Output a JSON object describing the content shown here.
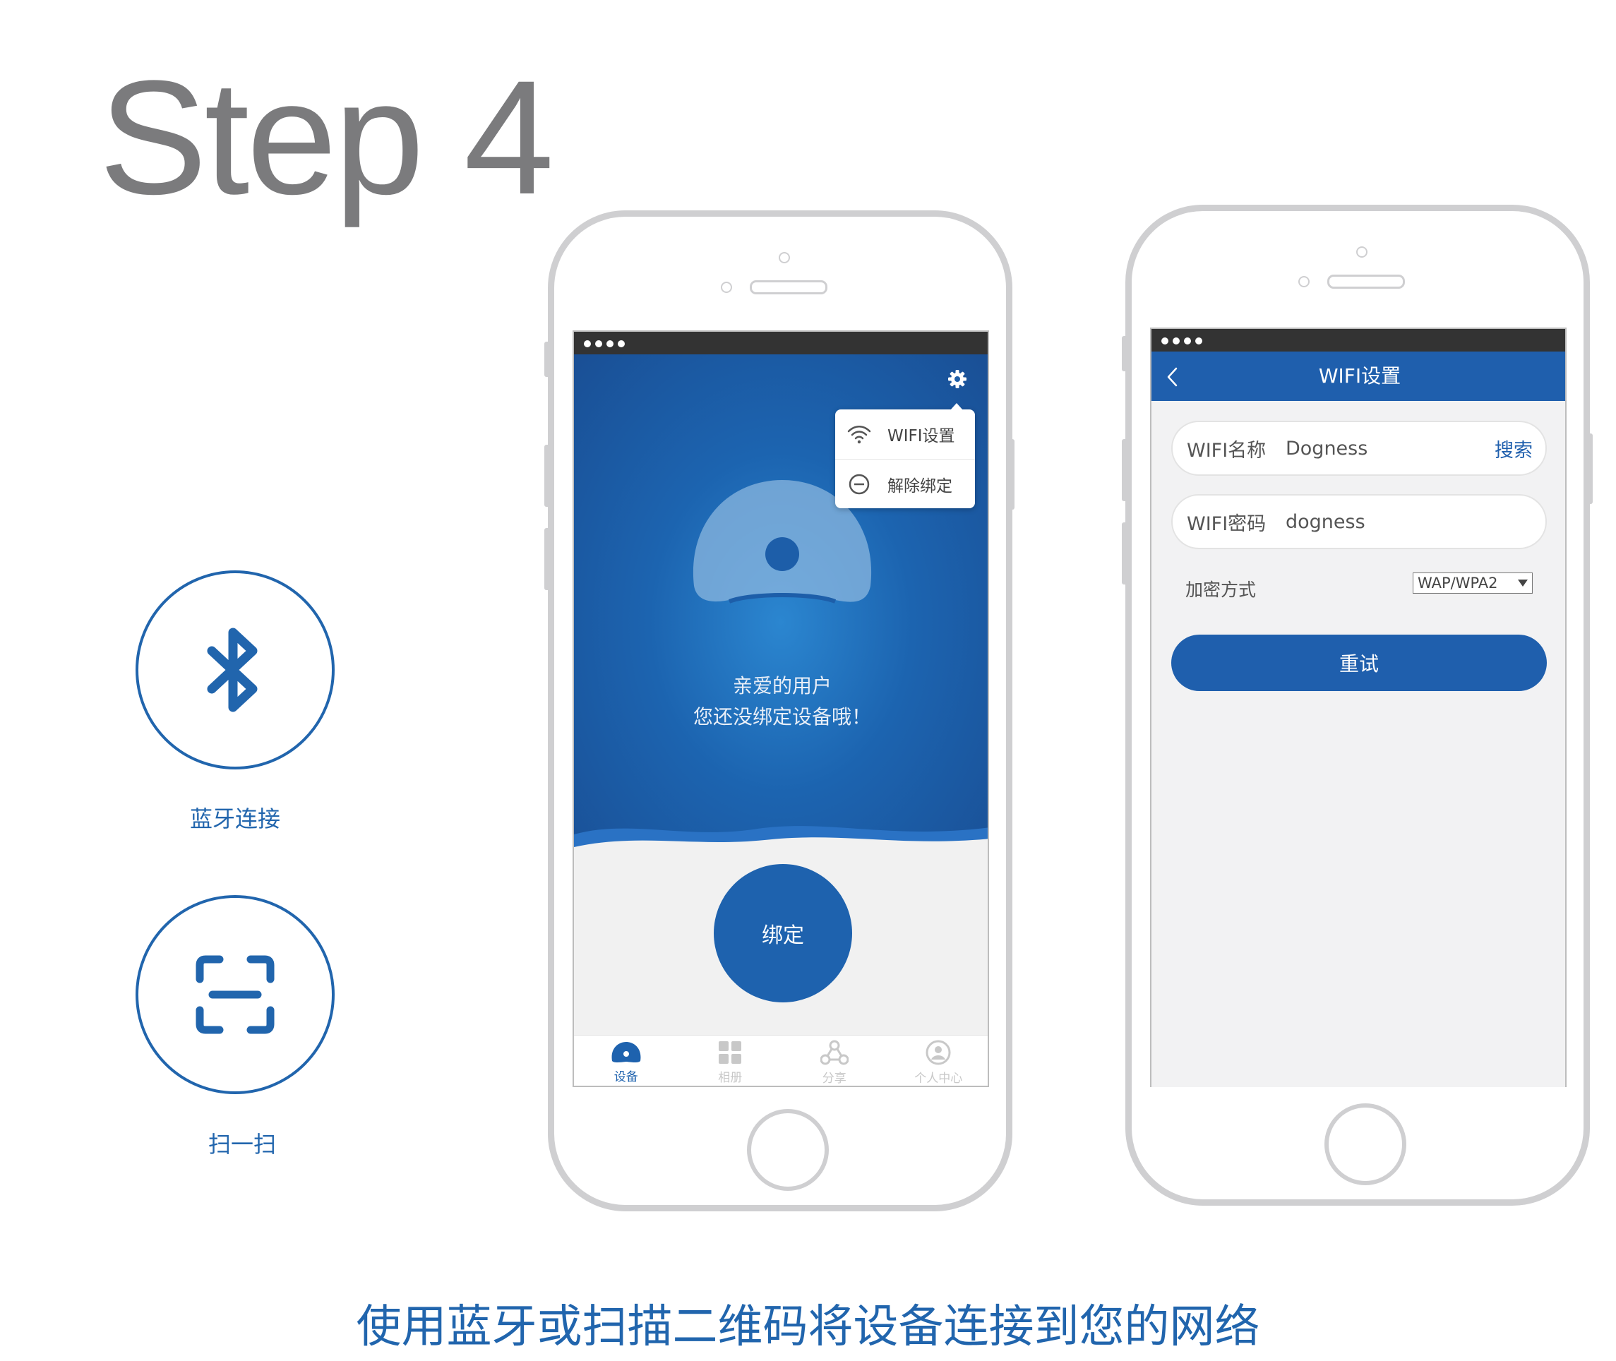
{
  "heading": "Step 4",
  "left_options": {
    "bluetooth": {
      "icon": "bluetooth-icon",
      "label": "蓝牙连接"
    },
    "scan": {
      "icon": "scan-qr-icon",
      "label": "扫一扫"
    }
  },
  "phone1": {
    "status_dots": 4,
    "settings_icon": "gear-icon",
    "menu": [
      {
        "icon": "wifi-icon",
        "label": "WIFI设置"
      },
      {
        "icon": "minus-circle-icon",
        "label": "解除绑定"
      }
    ],
    "message_line1": "亲爱的用户",
    "message_line2": "您还没绑定设备哦！",
    "bind_button": "绑定",
    "tabs": [
      {
        "icon": "device-icon",
        "label": "设备",
        "active": true
      },
      {
        "icon": "album-icon",
        "label": "相册",
        "active": false
      },
      {
        "icon": "share-icon",
        "label": "分享",
        "active": false
      },
      {
        "icon": "user-icon",
        "label": "个人中心",
        "active": false
      }
    ]
  },
  "phone2": {
    "status_dots": 4,
    "title": "WIFI设置",
    "wifi_name_label": "WIFI名称",
    "wifi_name_value": "Dogness",
    "search_link": "搜索",
    "wifi_password_label": "WIFI密码",
    "wifi_password_value": "dogness",
    "encryption_label": "加密方式",
    "encryption_value": "WAP/WPA2",
    "retry_button": "重试"
  },
  "caption": "使用蓝牙或扫描二维码将设备连接到您的网络",
  "colors": {
    "brand_blue": "#1f5fad",
    "heading_gray": "#7b7b7d",
    "phone_frame": "#cfcfd1"
  }
}
